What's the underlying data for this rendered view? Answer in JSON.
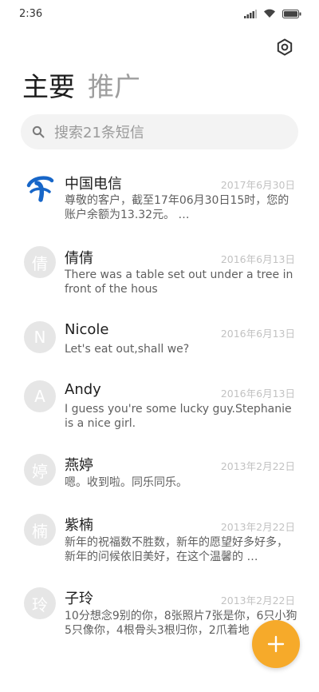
{
  "status_bar": {
    "time": "2:36",
    "icons": [
      "signal-icon",
      "wifi-icon",
      "battery-icon"
    ]
  },
  "header": {
    "settings_icon": "gear-icon",
    "tabs": [
      {
        "label": "主要",
        "active": true
      },
      {
        "label": "推广",
        "active": false
      }
    ]
  },
  "search": {
    "icon": "search-icon",
    "placeholder": "搜索21条短信"
  },
  "conversations": [
    {
      "name": "中国电信",
      "date": "2017年6月30日",
      "avatar": "",
      "avatar_icon": "china-telecom-logo",
      "preview": "尊敬的客户，截至17年06月30日15时，您的账户余额为13.32元。 …"
    },
    {
      "name": "倩倩",
      "date": "2016年6月13日",
      "avatar": "倩",
      "preview": "There was a table set out under a tree in front of the hous"
    },
    {
      "name": "Nicole",
      "date": "2016年6月13日",
      "avatar": "N",
      "preview": "Let's eat out,shall we?"
    },
    {
      "name": "Andy",
      "date": "2016年6月13日",
      "avatar": "A",
      "preview": "I guess you're some lucky guy.Stephanie is a nice girl."
    },
    {
      "name": "燕婷",
      "date": "2013年2月22日",
      "avatar": "婷",
      "preview": "嗯。收到啦。同乐同乐。"
    },
    {
      "name": "紫楠",
      "date": "2013年2月22日",
      "avatar": "楠",
      "preview": "新年的祝福数不胜数，新年的愿望好多好多，新年的问候依旧美好，在这个温馨的 …"
    },
    {
      "name": "子玲",
      "date": "2013年2月22日",
      "avatar": "玲",
      "preview": "10分想念9别的你，8张照片7张是你，6只小狗5只像你，4根骨头3根归你，2爪着地"
    }
  ],
  "fab": {
    "icon": "plus-icon",
    "accent": "#f6aa2a"
  }
}
